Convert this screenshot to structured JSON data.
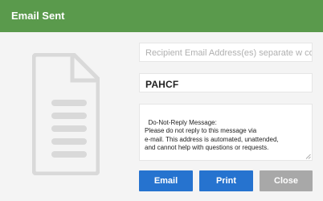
{
  "dialog": {
    "title": "Email Sent",
    "colors": {
      "header": "#5a9a4c",
      "primary_button": "#2673cf",
      "disabled_button": "#a8a8a8"
    }
  },
  "icon": {
    "name": "document-icon"
  },
  "form": {
    "recipient_placeholder": "Recipient Email Address(es) separate w comma",
    "subject_value": "PAHCF",
    "message_value": "Do-Not-Reply Message:\nPlease do not reply to this message via\ne-mail. This address is automated, unattended,\nand cannot help with questions or requests."
  },
  "buttons": {
    "email": "Email",
    "print": "Print",
    "close": "Close"
  }
}
